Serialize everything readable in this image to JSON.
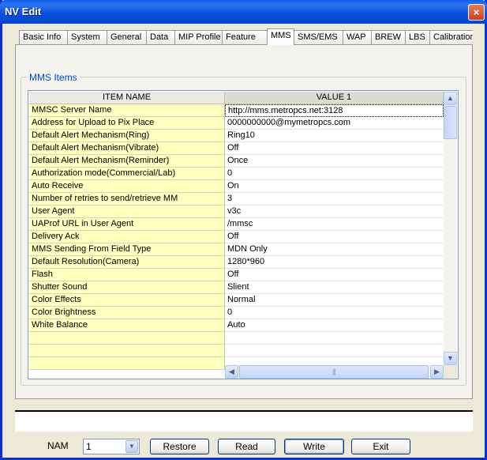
{
  "window": {
    "title": "NV Edit",
    "close_glyph": "×"
  },
  "tabs": [
    {
      "label": "Basic Info",
      "selected": false
    },
    {
      "label": "System",
      "selected": false
    },
    {
      "label": "General",
      "selected": false
    },
    {
      "label": "Data",
      "selected": false
    },
    {
      "label": "MIP Profile",
      "selected": false
    },
    {
      "label": "Feature",
      "selected": false
    },
    {
      "label": "MMS",
      "selected": true
    },
    {
      "label": "SMS/EMS",
      "selected": false
    },
    {
      "label": "WAP",
      "selected": false
    },
    {
      "label": "BREW",
      "selected": false
    },
    {
      "label": "LBS",
      "selected": false
    },
    {
      "label": "Calibration",
      "selected": false
    }
  ],
  "group": {
    "label": "MMS Items"
  },
  "grid": {
    "headers": {
      "name": "ITEM NAME",
      "value": "VALUE 1"
    },
    "rows": [
      {
        "name": "MMSC Server Name",
        "value": "http://mms.metropcs.net:3128"
      },
      {
        "name": "Address for Upload to Pix Place",
        "value": "0000000000@mymetropcs.com"
      },
      {
        "name": "Default Alert Mechanism(Ring)",
        "value": "Ring10"
      },
      {
        "name": "Default Alert Mechanism(Vibrate)",
        "value": "Off"
      },
      {
        "name": "Default Alert Mechanism(Reminder)",
        "value": "Once"
      },
      {
        "name": "Authorization mode(Commercial/Lab)",
        "value": "0"
      },
      {
        "name": "Auto Receive",
        "value": "On"
      },
      {
        "name": "Number of retries to send/retrieve MM",
        "value": "3"
      },
      {
        "name": "User Agent",
        "value": "v3c"
      },
      {
        "name": "UAProf URL in User Agent",
        "value": "/mmsc"
      },
      {
        "name": "Delivery Ack",
        "value": "Off"
      },
      {
        "name": "MMS Sending From Field Type",
        "value": "MDN Only"
      },
      {
        "name": "Default Resolution(Camera)",
        "value": "1280*960"
      },
      {
        "name": "Flash",
        "value": "Off"
      },
      {
        "name": "Shutter Sound",
        "value": "Slient"
      },
      {
        "name": "Color Effects",
        "value": "Normal"
      },
      {
        "name": "Color Brightness",
        "value": "0"
      },
      {
        "name": "White Balance",
        "value": "Auto"
      },
      {
        "name": "",
        "value": ""
      },
      {
        "name": "",
        "value": ""
      },
      {
        "name": "",
        "value": ""
      }
    ],
    "scroll_icons": {
      "up": "▲",
      "down": "▼",
      "left": "◀",
      "right": "▶",
      "grip": "|||"
    }
  },
  "footer": {
    "nam_label": "NAM",
    "nam_value": "1",
    "dropdown_glyph": "▼",
    "buttons": {
      "restore": "Restore",
      "read": "Read",
      "write": "Write",
      "exit": "Exit"
    }
  },
  "colors": {
    "title_bar": "#0A5FE8",
    "name_cell_bg": "#FFFFC0",
    "group_label": "#0046D5",
    "face": "#ECE9D8"
  }
}
